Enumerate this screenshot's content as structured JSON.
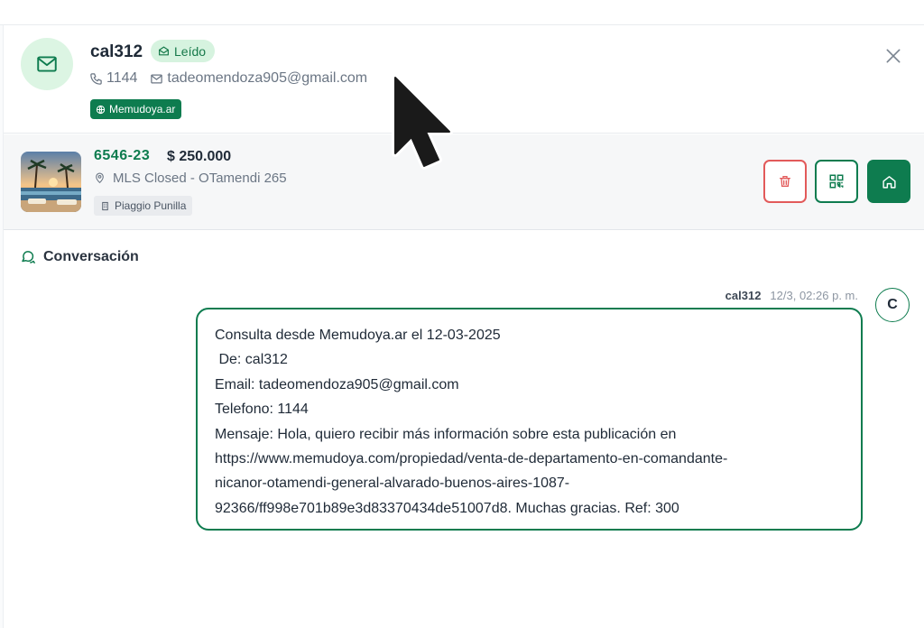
{
  "contact": {
    "name": "cal312",
    "status": "Leído",
    "phone": "1144",
    "email": "tadeomendoza905@gmail.com",
    "source": "Memudoya.ar"
  },
  "property": {
    "code": "6546-23",
    "price": "$ 250.000",
    "address": "MLS Closed - OTamendi 265",
    "building": "Piaggio Punilla"
  },
  "conversation": {
    "title": "Conversación",
    "message": {
      "sender": "cal312",
      "time": "12/3, 02:26 p. m.",
      "avatar_initial": "C",
      "lines": [
        "Consulta desde Memudoya.ar el 12-03-2025",
        " De: cal312",
        "Email: tadeomendoza905@gmail.com",
        "Telefono: 1144",
        "Mensaje: Hola, quiero recibir más información sobre esta publicación en",
        "https://www.memudoya.com/propiedad/venta-de-departamento-en-comandante-",
        "nicanor-otamendi-general-alvarado-buenos-aires-1087-",
        "92366/ff998e701b89e3d83370434de51007d8. Muchas gracias. Ref: 300"
      ]
    }
  },
  "icons": {
    "avatar": "envelope-icon",
    "status": "envelope-open-icon",
    "phone": "phone-icon",
    "email": "mail-icon",
    "source": "globe-icon",
    "close": "close-icon",
    "location": "map-pin-icon",
    "building": "building-icon",
    "delete": "trash-icon",
    "qr": "qr-code-icon",
    "home": "home-icon",
    "conversation": "chat-icon"
  },
  "colors": {
    "brand": "#0e7c4f",
    "danger": "#e25a5a",
    "badge_bg": "#d6f3df"
  }
}
